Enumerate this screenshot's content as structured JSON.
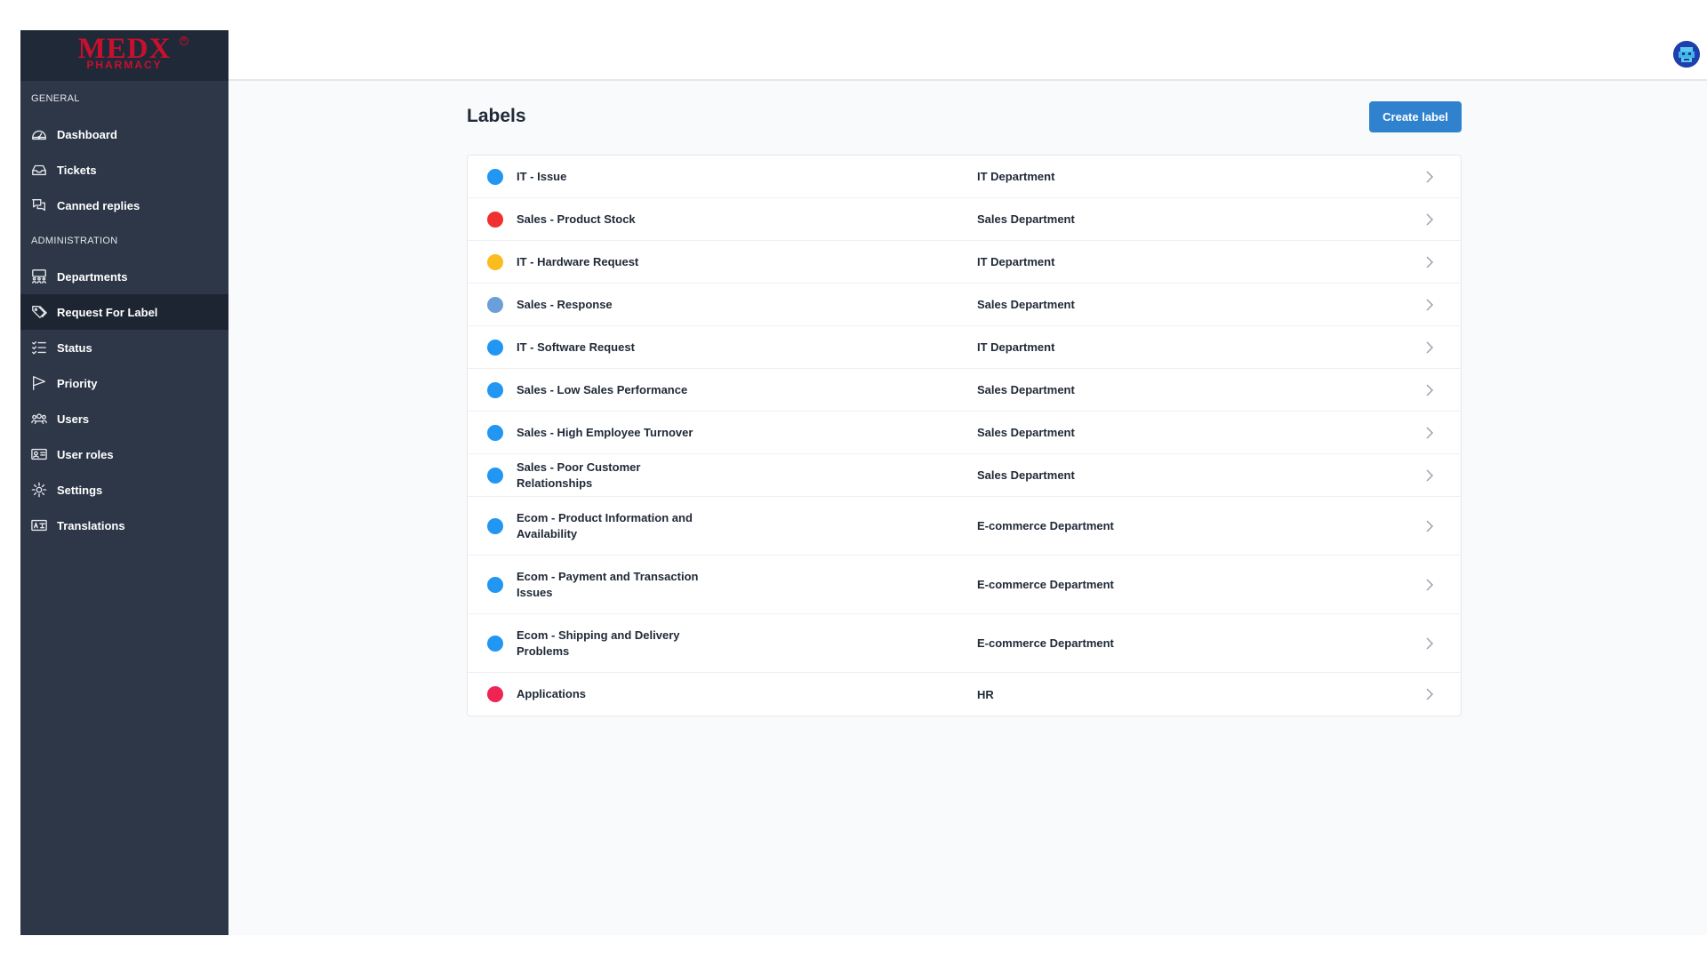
{
  "brand": {
    "logo_main": "MEDX",
    "logo_sub": "PHARMACY",
    "logo_reg": "R"
  },
  "sidebar": {
    "sections": [
      {
        "title": "GENERAL",
        "items": [
          {
            "label": "Dashboard",
            "icon": "dashboard-gauge-icon"
          },
          {
            "label": "Tickets",
            "icon": "inbox-tray-icon"
          },
          {
            "label": "Canned replies",
            "icon": "chat-bubbles-icon"
          }
        ]
      },
      {
        "title": "ADMINISTRATION",
        "items": [
          {
            "label": "Departments",
            "icon": "departments-icon"
          },
          {
            "label": "Request For Label",
            "icon": "tags-icon",
            "active": true
          },
          {
            "label": "Status",
            "icon": "checklist-icon"
          },
          {
            "label": "Priority",
            "icon": "flag-icon"
          },
          {
            "label": "Users",
            "icon": "users-icon"
          },
          {
            "label": "User roles",
            "icon": "id-card-icon"
          },
          {
            "label": "Settings",
            "icon": "gear-icon"
          },
          {
            "label": "Translations",
            "icon": "translate-icon"
          }
        ]
      }
    ]
  },
  "header": {
    "avatar_icon": "user-avatar-icon"
  },
  "main": {
    "title": "Labels",
    "create_button": "Create label",
    "labels": [
      {
        "name": "IT - Issue",
        "department": "IT Department",
        "color": "#2196f3"
      },
      {
        "name": "Sales - Product Stock",
        "department": "Sales Department",
        "color": "#f03030"
      },
      {
        "name": "IT - Hardware Request",
        "department": "IT Department",
        "color": "#fbbc1f"
      },
      {
        "name": "Sales - Response",
        "department": "Sales Department",
        "color": "#6b9fd9"
      },
      {
        "name": "IT - Software Request",
        "department": "IT Department",
        "color": "#2196f3"
      },
      {
        "name": "Sales - Low Sales Performance",
        "department": "Sales Department",
        "color": "#2196f3"
      },
      {
        "name": "Sales - High Employee Turnover",
        "department": "Sales Department",
        "color": "#2196f3"
      },
      {
        "name": "Sales - Poor Customer Relationships",
        "department": "Sales Department",
        "color": "#2196f3"
      },
      {
        "name": "Ecom - Product Information and Availability",
        "department": "E-commerce Department",
        "color": "#2196f3"
      },
      {
        "name": "Ecom - Payment and Transaction Issues",
        "department": "E-commerce Department",
        "color": "#2196f3"
      },
      {
        "name": "Ecom - Shipping and Delivery Problems",
        "department": "E-commerce Department",
        "color": "#2196f3"
      },
      {
        "name": "Applications",
        "department": "HR",
        "color": "#ee2453"
      }
    ]
  }
}
